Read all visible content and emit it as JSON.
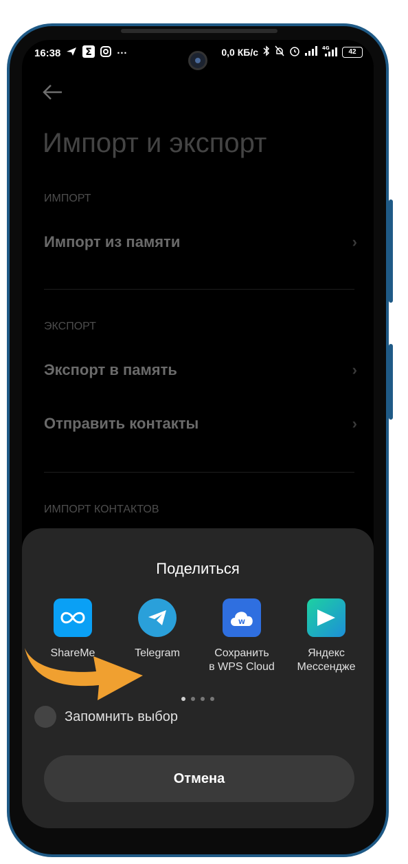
{
  "statusbar": {
    "time": "16:38",
    "network_speed": "0,0 КБ/с",
    "battery": "42",
    "dots": "···"
  },
  "page": {
    "title": "Импорт и экспорт",
    "sections": [
      {
        "label": "ИМПОРТ"
      },
      {
        "label": "ЭКСПОРТ"
      },
      {
        "label": "ИМПОРТ КОНТАКТОВ"
      }
    ],
    "items": {
      "import_from_memory": "Импорт из памяти",
      "export_to_memory": "Экспорт в память",
      "send_contacts": "Отправить контакты"
    }
  },
  "share_sheet": {
    "title": "Поделиться",
    "apps": [
      {
        "label": "ShareMe",
        "icon": "shareme-icon",
        "color": "#0aa0f5"
      },
      {
        "label": "Telegram",
        "icon": "telegram-icon",
        "color": "#2aa0da"
      },
      {
        "label": "Сохранить в WPS Cloud",
        "label_line1": "Сохранить",
        "label_line2": "в WPS Cloud",
        "icon": "wps-cloud-icon",
        "color": "#2f6fe0"
      },
      {
        "label": "Яндекс Мессендже",
        "label_line1": "Яндекс",
        "label_line2": "Мессендже",
        "icon": "yandex-messenger-icon",
        "color": "#1db9a8"
      }
    ],
    "remember_label": "Запомнить выбор",
    "cancel_label": "Отмена",
    "page_count": 4,
    "active_page": 1
  },
  "annotation": {
    "icon": "orange-arrow-icon",
    "color": "#f0a030"
  }
}
